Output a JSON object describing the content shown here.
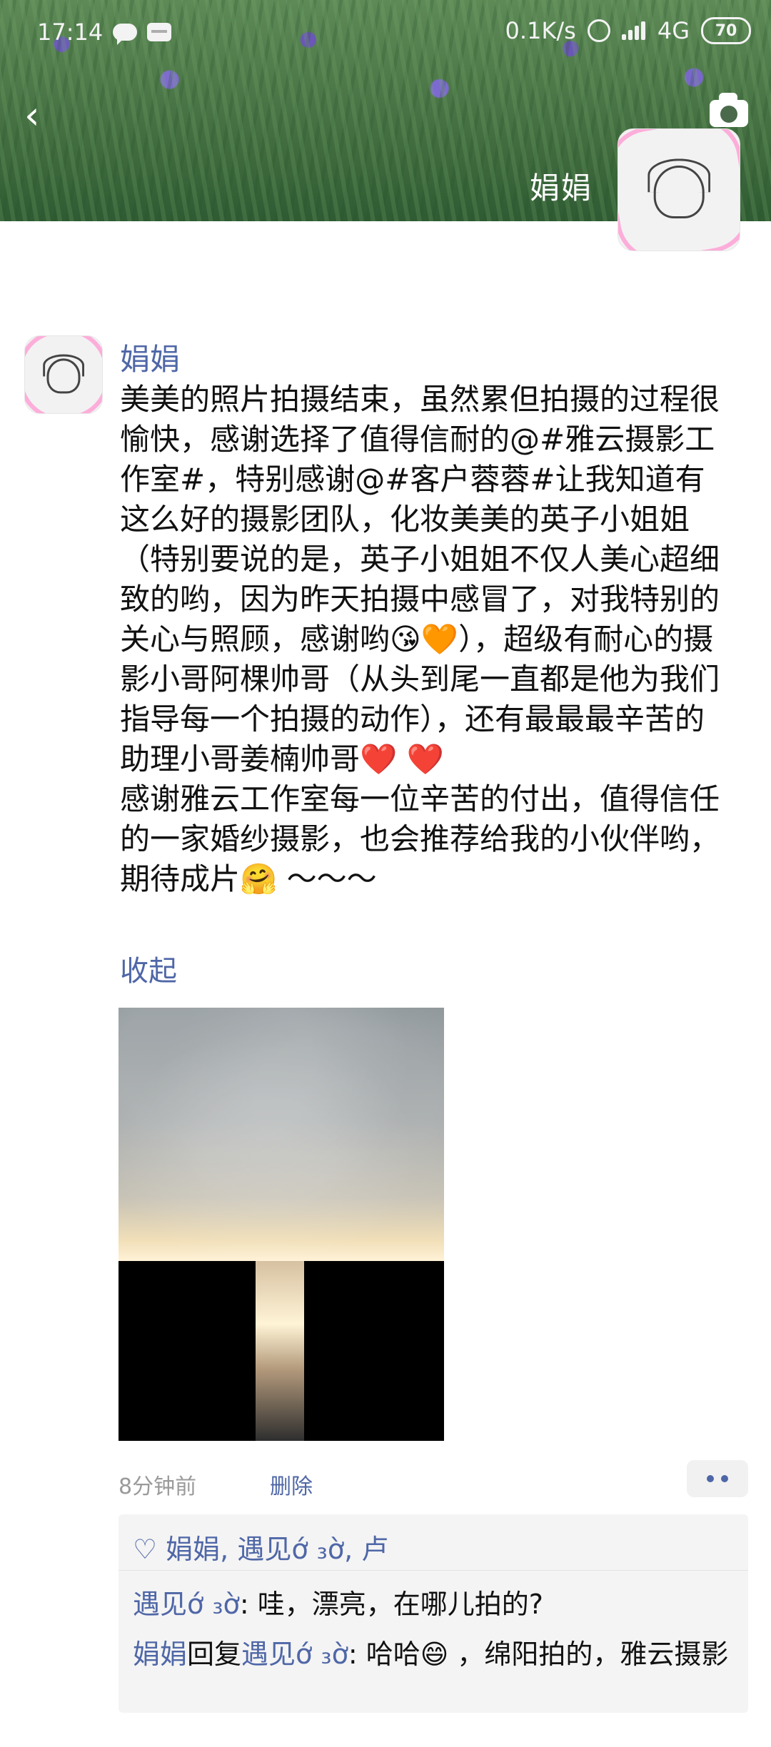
{
  "status_bar": {
    "time": "17:14",
    "speed": "0.1K/s",
    "network": "4G",
    "battery": "70"
  },
  "header": {
    "name": "娟娟"
  },
  "post": {
    "author": "娟娟",
    "text": "美美的照片拍摄结束，虽然累但拍摄的过程很愉快，感谢选择了值得信耐的@#雅云摄影工作室#，特别感谢@#客户蓉蓉#让我知道有这么好的摄影团队，化妆美美的英子小姐姐（特别要说的是，英子小姐姐不仅人美心超细致的哟，因为昨天拍摄中感冒了，对我特别的关心与照顾，感谢哟😘🧡），超级有耐心的摄影小哥阿棵帅哥（从头到尾一直都是他为我们指导每一个拍摄的动作），还有最最最辛苦的助理小哥姜楠帅哥❤️ ❤️\n感谢雅云工作室每一位辛苦的付出，值得信任的一家婚纱摄影，也会推荐给我的小伙伴哟，期待成片🤗 ～～～",
    "collapse": "收起",
    "time_ago": "8分钟前",
    "delete": "删除"
  },
  "likes": {
    "heart": "♡",
    "names": "娟娟, 遇见ớ ₃ờ, 卢"
  },
  "comments": [
    {
      "name": "遇见ớ ₃ờ",
      "sep": ": ",
      "text": "哇，漂亮，在哪儿拍的?"
    },
    {
      "name": "娟娟",
      "reply": "回复",
      "to": "遇见ớ ₃ờ",
      "sep": ": ",
      "text": "哈哈😄 ，绵阳拍的，雅云摄影"
    }
  ]
}
